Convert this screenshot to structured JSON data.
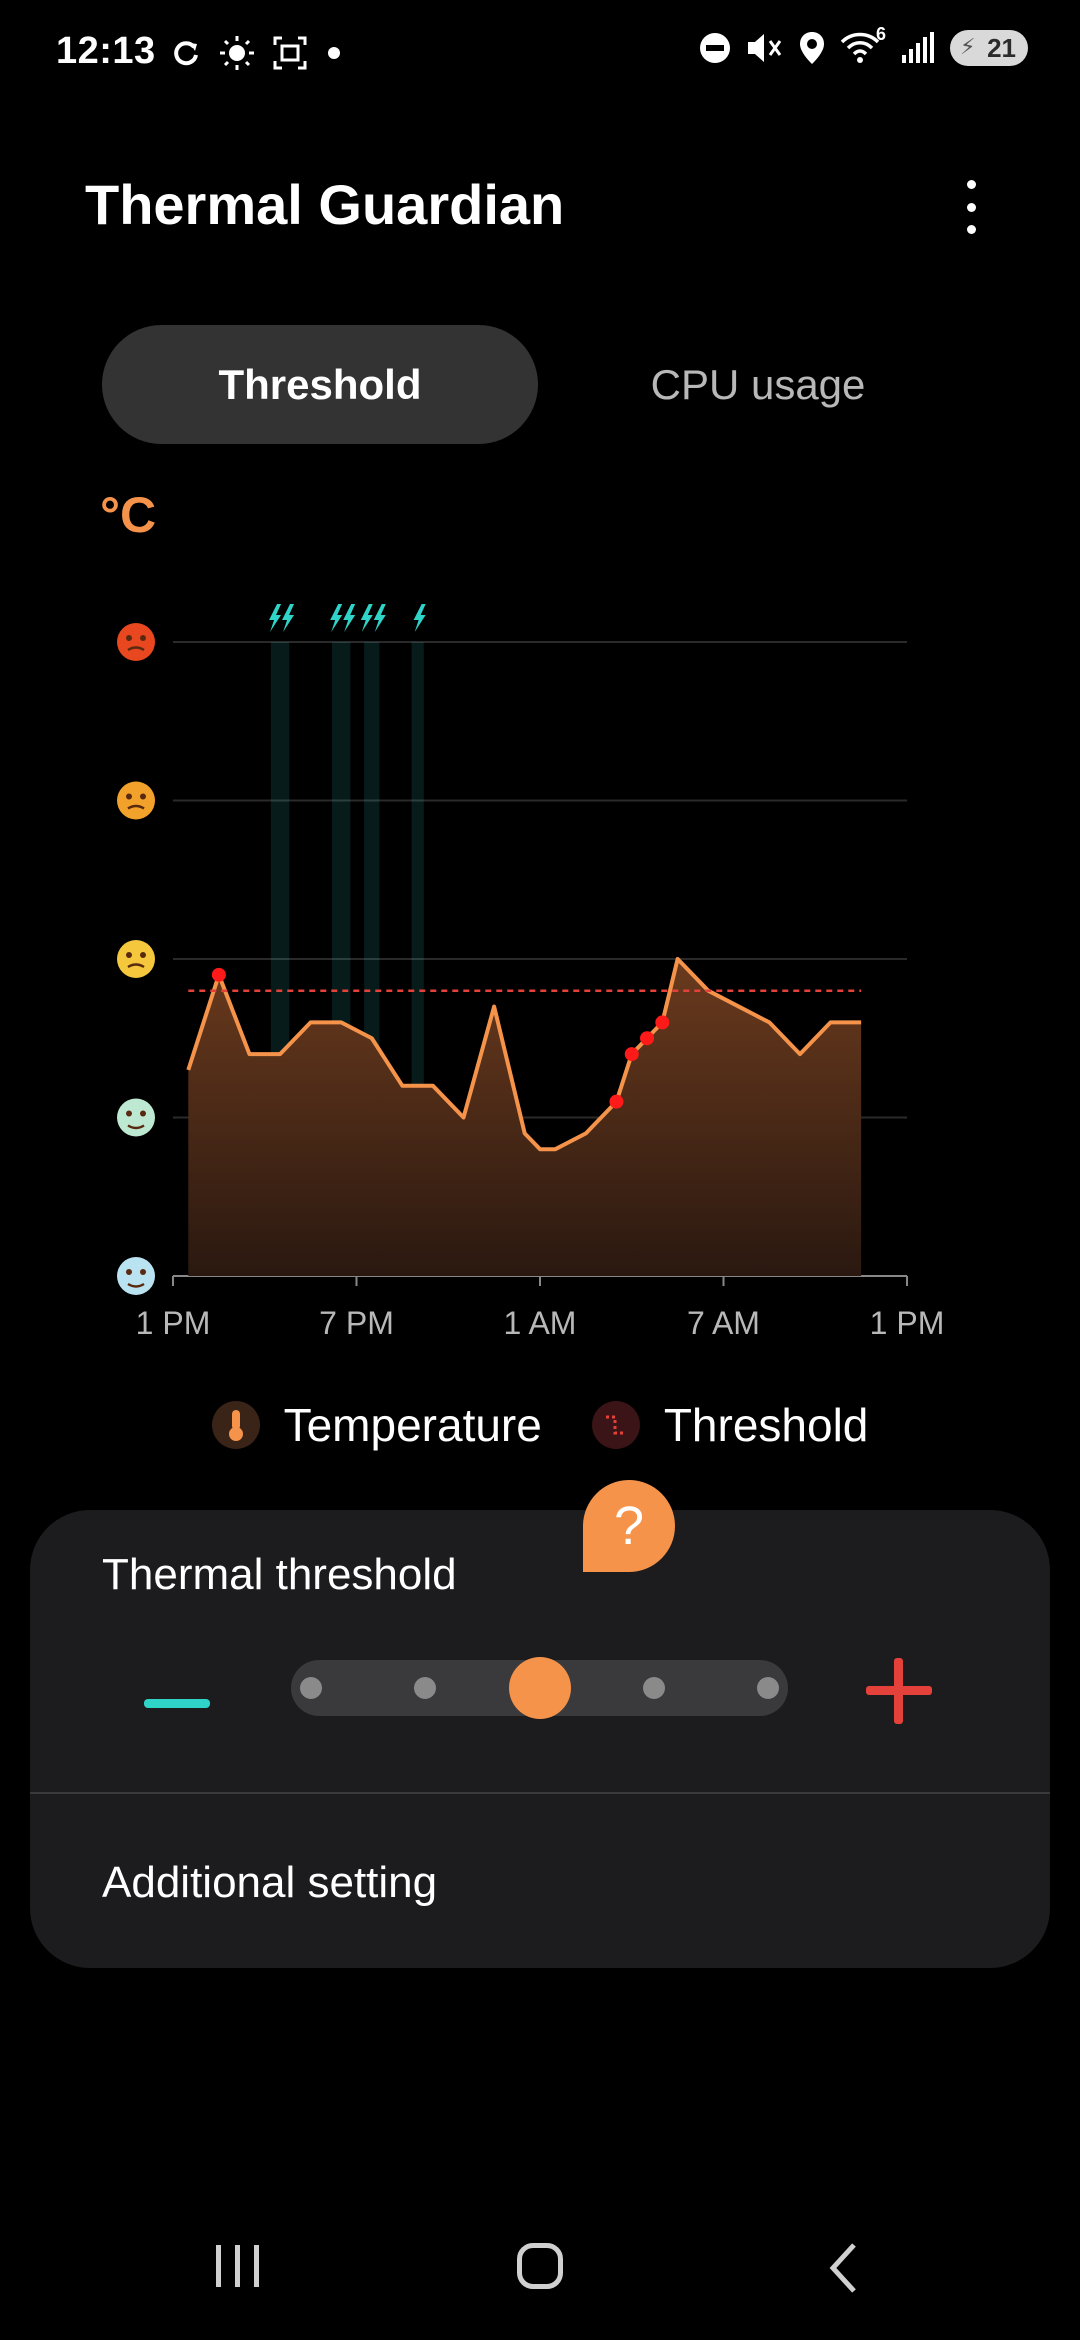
{
  "status_bar": {
    "time": "12:13",
    "left_icons": [
      "sync-icon",
      "brightness-icon",
      "screenshot-icon",
      "notification-dot-icon"
    ],
    "right_icons": [
      "dnd-icon",
      "mute-icon",
      "location-icon",
      "wifi-icon",
      "signal-icon"
    ],
    "wifi_label": "6",
    "battery": "21"
  },
  "app": {
    "title": "Thermal Guardian"
  },
  "tabs": [
    {
      "label": "Threshold",
      "active": true
    },
    {
      "label": "CPU usage",
      "active": false
    }
  ],
  "chart_data": {
    "type": "area",
    "unit_label": "°C",
    "x_ticks": [
      "1 PM",
      "7 PM",
      "1 AM",
      "7 AM",
      "1 PM"
    ],
    "x_range_hours": [
      0,
      24
    ],
    "y_levels": [
      "very-hot-face-icon",
      "hot-face-icon",
      "uneasy-face-icon",
      "relieved-face-icon",
      "cool-face-icon"
    ],
    "y_range": [
      0,
      4
    ],
    "threshold": 1.8,
    "series": [
      {
        "name": "Temperature",
        "x": [
          0.5,
          1.5,
          2.5,
          3.5,
          4.5,
          5.5,
          6.5,
          7.5,
          8.5,
          9.5,
          10.5,
          11.5,
          12.0,
          12.5,
          13.5,
          14.5,
          15.0,
          15.5,
          16.0,
          16.5,
          17.5,
          18.5,
          19.5,
          20.5,
          21.5,
          22.5
        ],
        "values": [
          1.3,
          1.9,
          1.4,
          1.4,
          1.6,
          1.6,
          1.5,
          1.2,
          1.2,
          1.0,
          1.7,
          0.9,
          0.8,
          0.8,
          0.9,
          1.1,
          1.4,
          1.5,
          1.6,
          2.0,
          1.8,
          1.7,
          1.6,
          1.4,
          1.6,
          1.6
        ]
      }
    ],
    "threshold_crossings": [
      1,
      15,
      16,
      17,
      18
    ],
    "cpu_spike_hours": [
      3.5,
      5.5,
      6.5,
      8.0
    ],
    "cpu_spike_widths": [
      0.6,
      0.6,
      0.5,
      0.4
    ],
    "cpu_spike_icons": [
      "bolt-icon-double",
      "bolt-icon-double",
      "bolt-icon-double",
      "bolt-icon"
    ]
  },
  "legend": {
    "temperature_label": "Temperature",
    "threshold_label": "Threshold"
  },
  "card": {
    "title": "Thermal threshold",
    "help_label": "?",
    "slider": {
      "steps": 5,
      "value": 3,
      "value_fraction": 0.5
    },
    "additional_setting_label": "Additional setting"
  },
  "colors": {
    "accent_orange": "#f5934a",
    "threshold_red": "#e3413a",
    "cpu_teal": "#2fd3c8",
    "background": "#000000",
    "card": "#1c1c1e"
  },
  "nav_bar": {
    "icons": [
      "recents-icon",
      "home-icon",
      "back-icon"
    ]
  }
}
